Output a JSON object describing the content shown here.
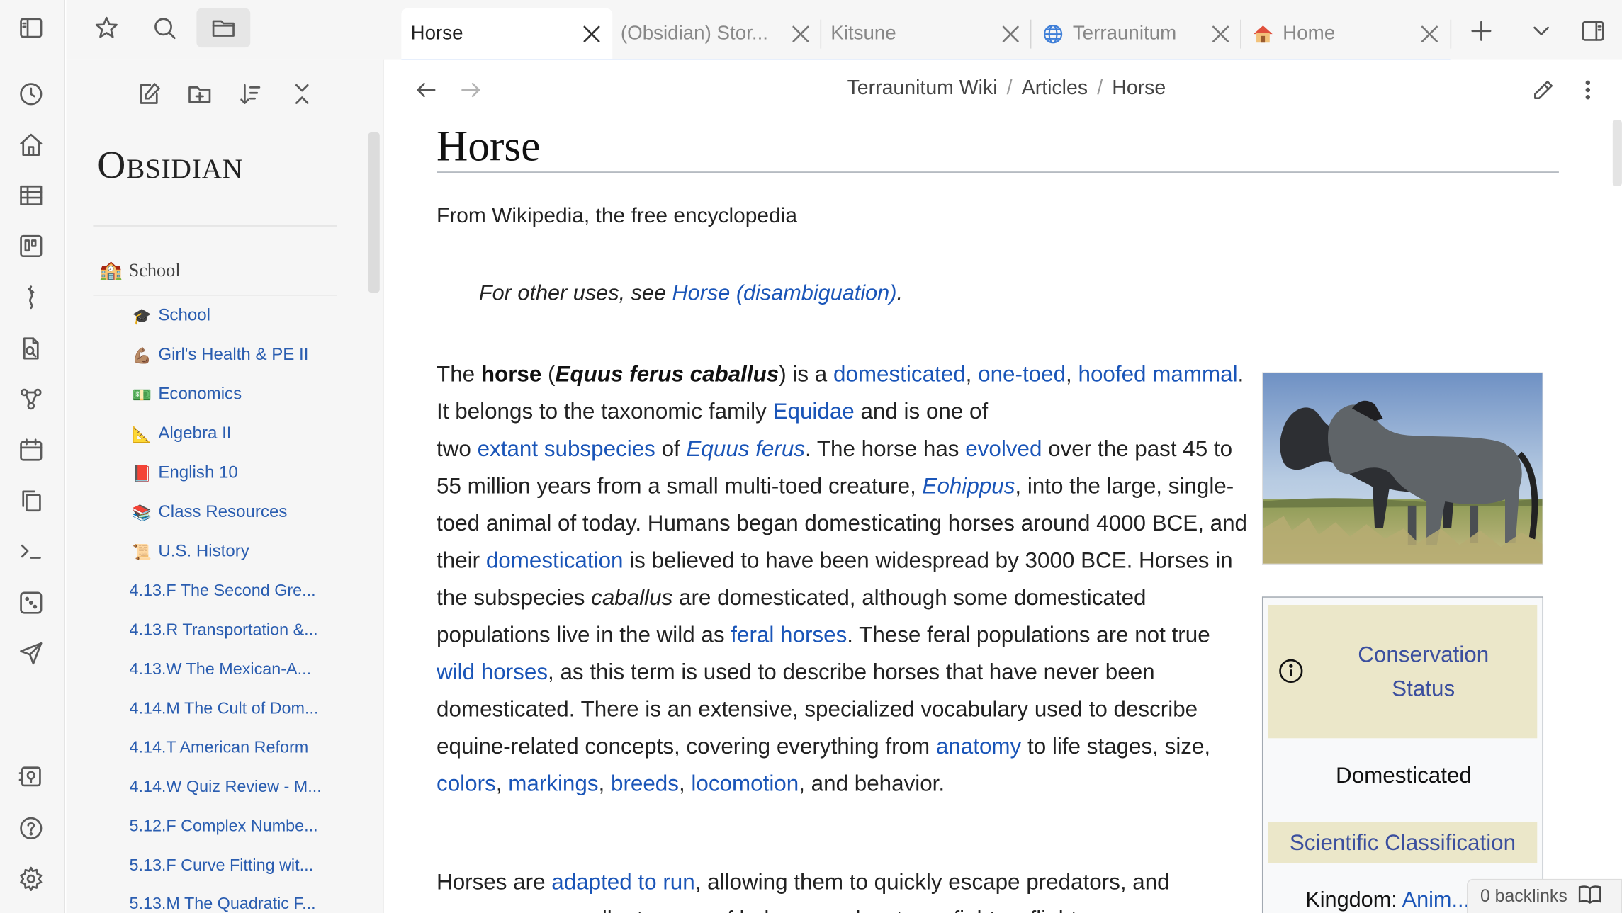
{
  "tabs": [
    {
      "label": "Horse",
      "active": true
    },
    {
      "label": "(Obsidian) Stor..."
    },
    {
      "label": "Kitsune"
    },
    {
      "label": "Terraunitum"
    },
    {
      "label": "Home"
    }
  ],
  "explorer": {
    "vault_name": "Obsidian",
    "folder": {
      "icon": "🏫",
      "label": "School"
    },
    "items": [
      {
        "icon": "🎓",
        "label": "School"
      },
      {
        "icon": "💪🏽",
        "label": "Girl's Health & PE II"
      },
      {
        "icon": "💵",
        "label": "Economics"
      },
      {
        "icon": "📐",
        "label": "Algebra II"
      },
      {
        "icon": "📕",
        "label": "English 10"
      },
      {
        "icon": "📚",
        "label": "Class Resources"
      },
      {
        "icon": "📜",
        "label": "U.S. History"
      }
    ],
    "files": [
      "4.13.F The Second Gre...",
      "4.13.R Transportation &...",
      "4.13.W The Mexican-A...",
      "4.14.M The Cult of Dom...",
      "4.14.T American Reform",
      "4.14.W Quiz Review - M...",
      "5.12.F Complex Numbe...",
      "5.13.F Curve Fitting wit...",
      "5.13.M The Quadratic F..."
    ]
  },
  "breadcrumb": [
    "Terraunitum Wiki",
    "Articles",
    "Horse"
  ],
  "article": {
    "title": "Horse",
    "from": "From Wikipedia, the free encyclopedia",
    "hatnote_prefix": "For other uses, see ",
    "hatnote_link": "Horse (disambiguation)",
    "hatnote_suffix": "."
  },
  "infobox": {
    "conservation_heading": "Conservation Status",
    "status": "Domesticated",
    "classification_heading": "Scientific Classification",
    "kingdom_label": "Kingdom: ",
    "kingdom_value": "Anim..."
  },
  "status_bar": {
    "backlinks": "0 backlinks"
  },
  "colors": {
    "link": "#1a55b8",
    "infobox_header_bg": "#ebe7c9",
    "infobox_header_text": "#3b4f9e"
  }
}
